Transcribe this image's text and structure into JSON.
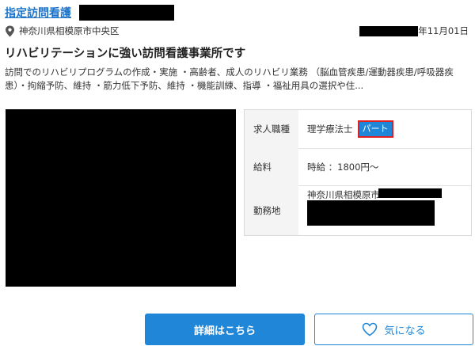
{
  "listing": {
    "title": "指定訪問看護",
    "location": "神奈川県相模原市中央区",
    "date_suffix": "年11月01日",
    "headline": "リハビリテーションに強い訪問看護事業所です",
    "description": "訪問でのリハビリプログラムの作成・実施 ・高齢者、成人のリハビリ業務 （脳血管疾患/運動器疾患/呼吸器疾患）・拘縮予防、維持 ・筋力低下予防、維持 ・機能訓練、指導 ・福祉用具の選択や住..."
  },
  "details": {
    "job_label": "求人職種",
    "job_value": "理学療法士",
    "job_badge": "パート",
    "salary_label": "給料",
    "salary_value": "時給 ：1800円～",
    "workplace_label": "勤務地",
    "workplace_value": "神奈川県相模原市"
  },
  "actions": {
    "detail_button": "詳細はこちら",
    "favorite_button": "気になる"
  },
  "colors": {
    "accent": "#1f86d8",
    "title_link": "#1a73c8",
    "badge_border": "#e02020"
  },
  "icons": {
    "location": "map-pin-icon",
    "favorite": "heart-outline-icon"
  }
}
